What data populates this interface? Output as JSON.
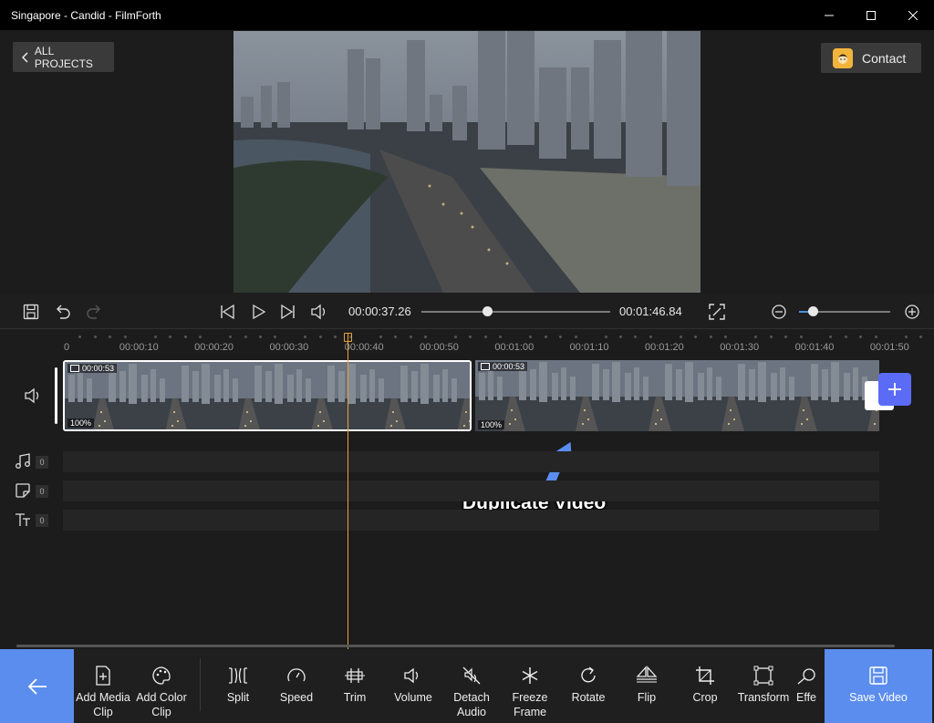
{
  "window": {
    "title": "Singapore - Candid - FilmForth"
  },
  "header": {
    "back_label": "ALL PROJECTS",
    "contact_label": "Contact"
  },
  "transport": {
    "current_time": "00:00:37.26",
    "total_time": "00:01:46.84",
    "seek_progress": 0.35,
    "zoom_level": 0.15
  },
  "ruler": {
    "labels": [
      "0",
      "00:00:10",
      "00:00:20",
      "00:00:30",
      "00:00:40",
      "00:00:50",
      "00:01:00",
      "00:01:10",
      "00:01:20",
      "00:01:30",
      "00:01:40",
      "00:01:50"
    ]
  },
  "timeline": {
    "clips": [
      {
        "duration": "00:00:53",
        "volume": "100%",
        "selected": true
      },
      {
        "duration": "00:00:53",
        "volume": "100%",
        "selected": false
      }
    ],
    "lanes": [
      {
        "icon": "music-note-icon",
        "count": "0"
      },
      {
        "icon": "sticker-icon",
        "count": "0"
      },
      {
        "icon": "text-icon",
        "count": "0"
      }
    ]
  },
  "annotation": {
    "text": "Duplicate Video"
  },
  "toolbar": {
    "tools": [
      {
        "id": "add-media-clip",
        "label": "Add Media\nClip"
      },
      {
        "id": "add-color-clip",
        "label": "Add Color\nClip"
      },
      {
        "id": "split",
        "label": "Split"
      },
      {
        "id": "speed",
        "label": "Speed"
      },
      {
        "id": "trim",
        "label": "Trim"
      },
      {
        "id": "volume",
        "label": "Volume"
      },
      {
        "id": "detach-audio",
        "label": "Detach\nAudio"
      },
      {
        "id": "freeze-frame",
        "label": "Freeze\nFrame"
      },
      {
        "id": "rotate",
        "label": "Rotate"
      },
      {
        "id": "flip",
        "label": "Flip"
      },
      {
        "id": "crop",
        "label": "Crop"
      },
      {
        "id": "transform",
        "label": "Transform"
      },
      {
        "id": "effects",
        "label": "Effe"
      }
    ],
    "save_label": "Save Video"
  },
  "colors": {
    "accent": "#5b8dee",
    "playhead": "#e8a43a",
    "add_button": "#5b6bf5"
  }
}
